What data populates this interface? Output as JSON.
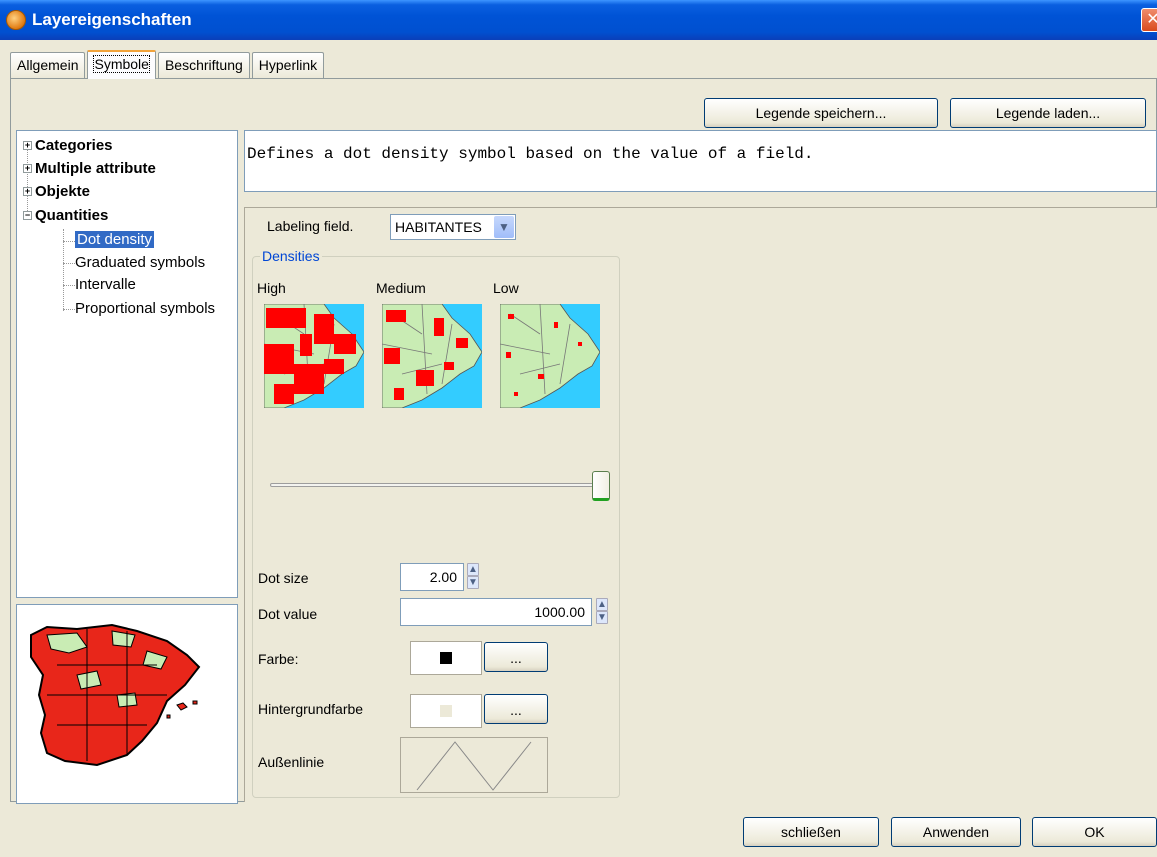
{
  "window": {
    "title": "Layereigenschaften",
    "close_glyph": "✕"
  },
  "tabs": [
    {
      "label": "Allgemein"
    },
    {
      "label": "Symbole"
    },
    {
      "label": "Beschriftung"
    },
    {
      "label": "Hyperlink"
    }
  ],
  "toolbar": {
    "save_legend": "Legende speichern...",
    "load_legend": "Legende laden..."
  },
  "tree": {
    "items": [
      {
        "label": "Categories",
        "expander": "+"
      },
      {
        "label": "Multiple attribute",
        "expander": "+"
      },
      {
        "label": "Objekte",
        "expander": "+"
      },
      {
        "label": "Quantities",
        "expander": "−"
      },
      {
        "label": "Dot density"
      },
      {
        "label": "Graduated symbols"
      },
      {
        "label": "Intervalle"
      },
      {
        "label": "Proportional symbols"
      }
    ]
  },
  "description": "Defines a dot density symbol based on the value of a field.",
  "options": {
    "labeling_field_label": "Labeling field.",
    "labeling_field_value": "HABITANTES",
    "densities_title": "Densities",
    "density_high": "High",
    "density_medium": "Medium",
    "density_low": "Low",
    "density_level": 1.0,
    "dot_size_label": "Dot size",
    "dot_size_value": "2.00",
    "dot_value_label": "Dot value",
    "dot_value_value": "1000.00",
    "color_label": "Farbe:",
    "color_button": "...",
    "bg_color_label": "Hintergrundfarbe",
    "bg_color_button": "...",
    "outline_label": "Außenlinie",
    "color_value": "#000000",
    "bg_color_value": "#ece9d8"
  },
  "footer": {
    "close": "schließen",
    "apply": "Anwenden",
    "ok": "OK"
  },
  "colors": {
    "sea": "#33ccff",
    "land": "#c9ecb4",
    "dots": "#ff0000",
    "selection": "#316ac5"
  }
}
